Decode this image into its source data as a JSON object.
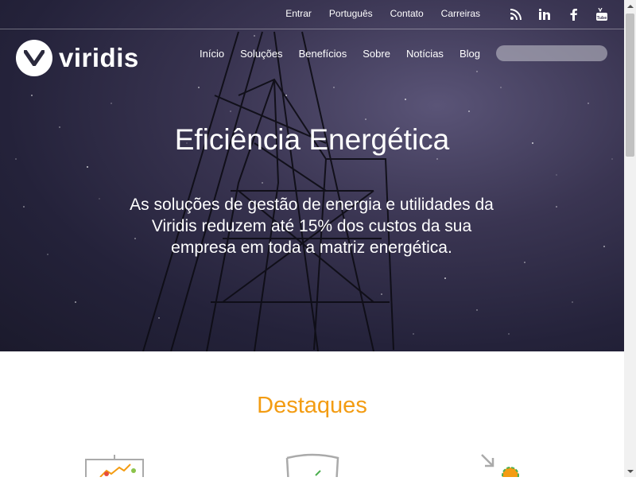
{
  "topbar": {
    "links": [
      "Entrar",
      "Português",
      "Contato",
      "Carreiras"
    ],
    "social": [
      "rss-icon",
      "linkedin-icon",
      "facebook-icon",
      "youtube-icon"
    ]
  },
  "brand": {
    "name": "viridis",
    "mark": "v"
  },
  "nav": [
    "Início",
    "Soluções",
    "Benefícios",
    "Sobre",
    "Notícias",
    "Blog"
  ],
  "search": {
    "placeholder": "",
    "value": ""
  },
  "hero": {
    "title": "Eficiência Energética",
    "subtitle": "As soluções de gestão de energia e utilidades da Viridis reduzem até 15% dos custos da sua empresa em toda a matriz energética."
  },
  "section": {
    "title": "Destaques"
  },
  "colors": {
    "accent": "#f39c12",
    "white": "#ffffff"
  }
}
